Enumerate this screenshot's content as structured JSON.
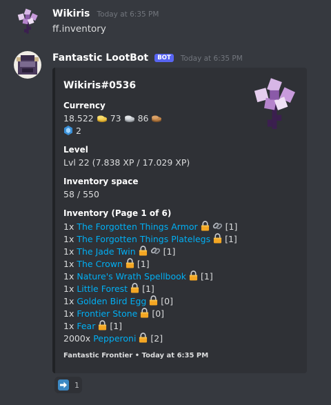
{
  "user_message": {
    "author": "Wikiris",
    "timestamp": "Today at 6:35 PM",
    "content": "ff.inventory"
  },
  "bot_message": {
    "author": "Fantastic LootBot",
    "badge": "BOT",
    "timestamp": "Today at 6:35 PM",
    "embed": {
      "title": "Wikiris#0536",
      "currency_label": "Currency",
      "currency_gold": "18.522",
      "currency_silver": "73",
      "currency_bronze": "86",
      "currency_gem": "2",
      "level_label": "Level",
      "level_value": "Lvl 22 (7.838 XP / 17.029 XP)",
      "space_label": "Inventory space",
      "space_value": "58 / 550",
      "inventory_label": "Inventory (Page 1 of 6)",
      "items": [
        {
          "qty": "1x",
          "name": "The Forgotten Things Armor",
          "chain": true,
          "count": "[1]"
        },
        {
          "qty": "1x",
          "name": "The Forgotten Things Platelegs",
          "chain": false,
          "count": "[1]"
        },
        {
          "qty": "1x",
          "name": "The Jade Twin",
          "chain": true,
          "count": "[1]"
        },
        {
          "qty": "1x",
          "name": "The Crown",
          "chain": false,
          "count": "[1]"
        },
        {
          "qty": "1x",
          "name": "Nature's Wrath Spellbook",
          "chain": false,
          "count": "[1]"
        },
        {
          "qty": "1x",
          "name": "Little Forest",
          "chain": false,
          "count": "[1]"
        },
        {
          "qty": "1x",
          "name": "Golden Bird Egg",
          "chain": false,
          "count": "[0]"
        },
        {
          "qty": "1x",
          "name": "Frontier Stone",
          "chain": false,
          "count": "[0]"
        },
        {
          "qty": "1x",
          "name": "Fear",
          "chain": false,
          "count": "[1]"
        },
        {
          "qty": "2000x",
          "name": "Pepperoni",
          "chain": false,
          "count": "[2]"
        }
      ],
      "footer": "Fantastic Frontier • Today at 6:35 PM"
    },
    "reaction_count": "1"
  },
  "icons": {
    "avatar_user": "flower-avatar-icon",
    "avatar_bot": "lootbot-avatar-icon",
    "thumbnail": "flower-thumbnail-icon",
    "lock": "lock-icon",
    "chain": "chain-icon",
    "reaction": "arrow-right-emoji-icon"
  },
  "colors": {
    "link": "#00aff4",
    "badge": "#5865f2",
    "background": "#36393f",
    "embed": "#2f3136"
  }
}
